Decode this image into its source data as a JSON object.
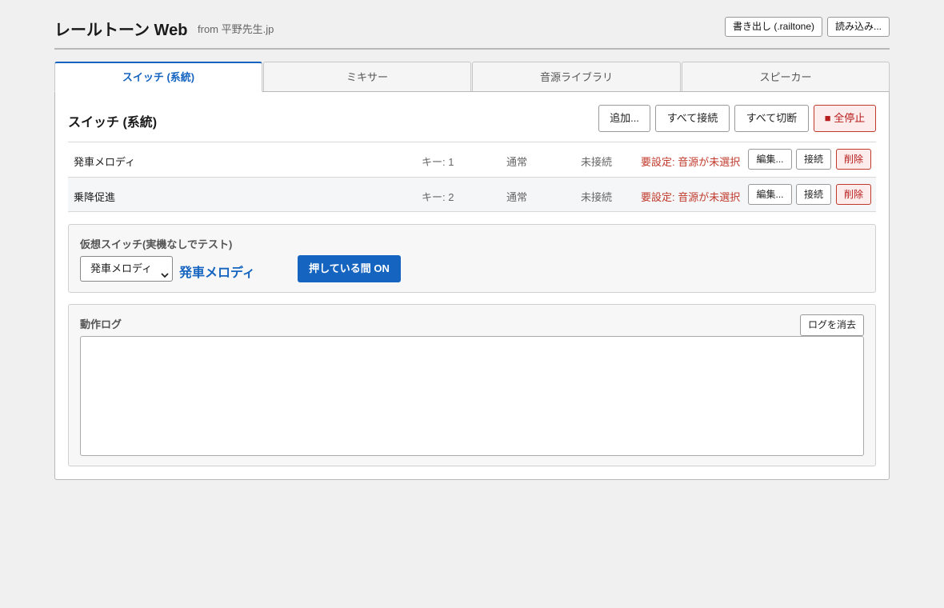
{
  "header": {
    "title": "レールトーン Web",
    "subtitle": "from 平野先生.jp",
    "export_label": "書き出し (.railtone)",
    "import_label": "読み込み..."
  },
  "tabs": [
    {
      "label": "スイッチ (系統)",
      "active": true
    },
    {
      "label": "ミキサー",
      "active": false
    },
    {
      "label": "音源ライブラリ",
      "active": false
    },
    {
      "label": "スピーカー",
      "active": false
    }
  ],
  "switch_section": {
    "title": "スイッチ (系統)",
    "add_label": "追加...",
    "connect_all_label": "すべて接続",
    "disconnect_all_label": "すべて切断",
    "stop_all_label": "■ 全停止"
  },
  "switches": [
    {
      "name": "発車メロディ",
      "key": "キー: 1",
      "mode": "通常",
      "connection": "未接続",
      "warning": "要設定: 音源が未選択",
      "edit_label": "編集...",
      "connect_label": "接続",
      "delete_label": "削除"
    },
    {
      "name": "乗降促進",
      "key": "キー: 2",
      "mode": "通常",
      "connection": "未接続",
      "warning": "要設定: 音源が未選択",
      "edit_label": "編集...",
      "connect_label": "接続",
      "delete_label": "削除"
    }
  ],
  "virtual_switch": {
    "title": "仮想スイッチ(実機なしでテスト)",
    "selected": "発車メロディ",
    "selected_display": "発車メロディ",
    "press_label": "押している間 ON"
  },
  "log": {
    "title": "動作ログ",
    "clear_label": "ログを消去",
    "content": ""
  },
  "colors": {
    "accent": "#1565c0",
    "danger": "#c0392b",
    "background": "#f0f0f0"
  }
}
